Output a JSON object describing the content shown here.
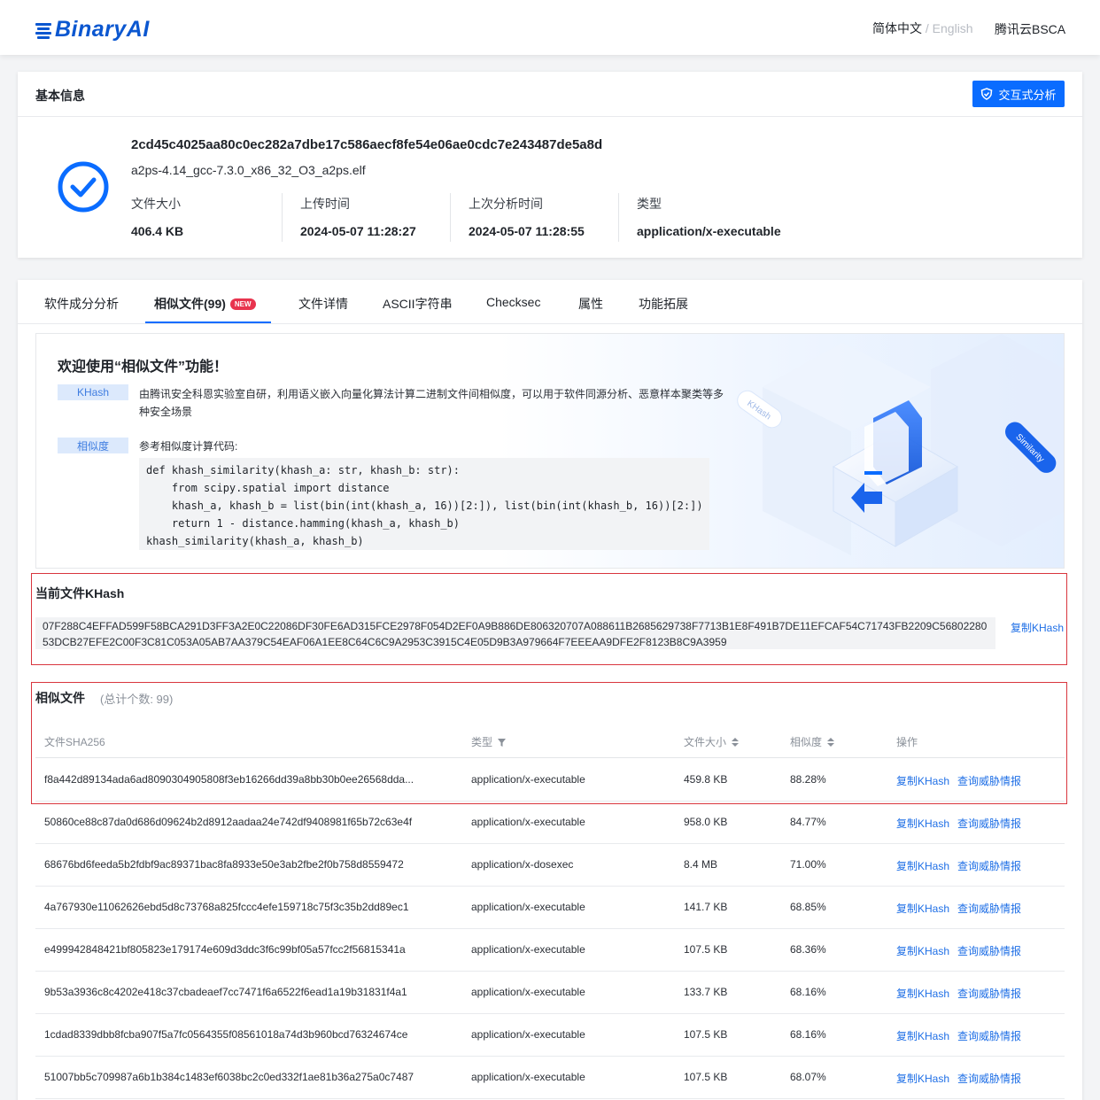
{
  "header": {
    "logo_text": "BinaryAI",
    "lang_active": "简体中文",
    "lang_separator": "/",
    "lang_inactive": "English",
    "bsca_link": "腾讯云BSCA"
  },
  "basic_info": {
    "title": "基本信息",
    "interactive_button": "交互式分析",
    "sha256": "2cd45c4025aa80c0ec282a7dbe17c586aecf8fe54e06ae0cdc7e243487de5a8d",
    "file_name": "a2ps-4.14_gcc-7.3.0_x86_32_O3_a2ps.elf",
    "size_label": "文件大小",
    "size_value": "406.4 KB",
    "upload_label": "上传时间",
    "upload_value": "2024-05-07 11:28:27",
    "analysis_label": "上次分析时间",
    "analysis_value": "2024-05-07 11:28:55",
    "type_label": "类型",
    "type_value": "application/x-executable"
  },
  "tabs": [
    {
      "label": "软件成分分析"
    },
    {
      "label": "相似文件(99)",
      "badge": "NEW"
    },
    {
      "label": "文件详情"
    },
    {
      "label": "ASCII字符串"
    },
    {
      "label": "Checksec"
    },
    {
      "label": "属性"
    },
    {
      "label": "功能拓展"
    }
  ],
  "banner": {
    "title": "欢迎使用“相似文件”功能！",
    "khash_tag": "KHash",
    "khash_desc": "由腾讯安全科恩实验室自研，利用语义嵌入向量化算法计算二进制文件间相似度，可以用于软件同源分析、恶意样本聚类等多种安全场景",
    "sim_tag": "相似度",
    "sim_desc": "参考相似度计算代码:",
    "code": "def khash_similarity(khash_a: str, khash_b: str):\n    from scipy.spatial import distance\n    khash_a, khash_b = list(bin(int(khash_a, 16))[2:]), list(bin(int(khash_b, 16))[2:])\n    return 1 - distance.hamming(khash_a, khash_b)\nkhash_similarity(khash_a, khash_b)",
    "illus_label_khash": "KHash",
    "illus_label_similarity": "Similarity"
  },
  "current_khash": {
    "title": "当前文件KHash",
    "value": "07F288C4EFFAD599F58BCA291D3FF3A2E0C22086DF30FE6AD315FCE2978F054D2EF0A9B886DE806320707A088611B2685629738F7713B1E8F491B7DE11EFCAF54C71743FB2209C5680228053DCB27EFE2C00F3C81C053A05AB7AA379C54EAF06A1EE8C64C6C9A2953C3915C4E05D9B3A979664F7EEEAA9DFE2F8123B8C9A3959",
    "copy_label": "复制KHash"
  },
  "similar_files": {
    "title": "相似文件",
    "count_text": "(总计个数: 99)",
    "columns": [
      "文件SHA256",
      "类型",
      "文件大小",
      "相似度",
      "操作"
    ],
    "op_copy": "复制KHash",
    "op_query": "查询威胁情报",
    "rows": [
      {
        "sha": "f8a442d89134ada6ad8090304905808f3eb16266dd39a8bb30b0ee26568dda...",
        "type": "application/x-executable",
        "size": "459.8 KB",
        "sim": "88.28%"
      },
      {
        "sha": "50860ce88c87da0d686d09624b2d8912aadaa24e742df9408981f65b72c63e4f",
        "type": "application/x-executable",
        "size": "958.0 KB",
        "sim": "84.77%"
      },
      {
        "sha": "68676bd6feeda5b2fdbf9ac89371bac8fa8933e50e3ab2fbe2f0b758d8559472",
        "type": "application/x-dosexec",
        "size": "8.4 MB",
        "sim": "71.00%"
      },
      {
        "sha": "4a767930e11062626ebd5d8c73768a825fccc4efe159718c75f3c35b2dd89ec1",
        "type": "application/x-executable",
        "size": "141.7 KB",
        "sim": "68.85%"
      },
      {
        "sha": "e499942848421bf805823e179174e609d3ddc3f6c99bf05a57fcc2f56815341a",
        "type": "application/x-executable",
        "size": "107.5 KB",
        "sim": "68.36%"
      },
      {
        "sha": "9b53a3936c8c4202e418c37cbadeaef7cc7471f6a6522f6ead1a19b31831f4a1",
        "type": "application/x-executable",
        "size": "133.7 KB",
        "sim": "68.16%"
      },
      {
        "sha": "1cdad8339dbb8fcba907f5a7fc0564355f08561018a74d3b960bcd76324674ce",
        "type": "application/x-executable",
        "size": "107.5 KB",
        "sim": "68.16%"
      },
      {
        "sha": "51007bb5c709987a6b1b384c1483ef6038bc2c0ed332f1ae81b36a275a0c7487",
        "type": "application/x-executable",
        "size": "107.5 KB",
        "sim": "68.07%"
      }
    ]
  },
  "colors": {
    "brand": "#0b57d0",
    "primary_button": "#0a6cff",
    "link": "#1f6fe6",
    "highlight_border": "#d9363e",
    "new_badge": "#e8344e"
  }
}
